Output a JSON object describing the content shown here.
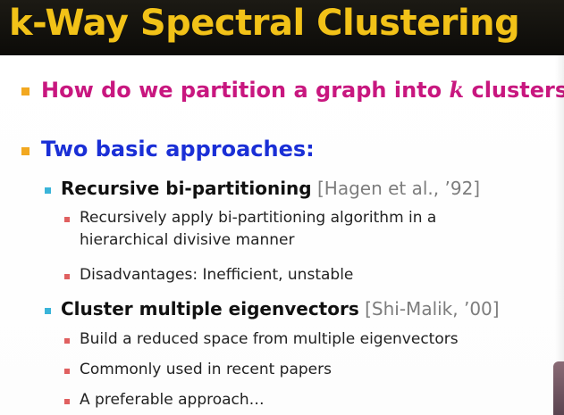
{
  "title": "k-Way Spectral Clustering",
  "q1": {
    "before": "How do we partition a graph into ",
    "k": "k",
    "after": " clusters?"
  },
  "q2": "Two basic approaches:",
  "approach1": {
    "name": "Recursive bi-partitioning",
    "cite": "[Hagen et al., ’92]",
    "points": [
      "Recursively apply bi-partitioning algorithm in a",
      "hierarchical divisive manner",
      "Disadvantages: Inefficient, unstable"
    ]
  },
  "approach2": {
    "name": "Cluster multiple eigenvectors",
    "cite": "[Shi-Malik, ’00]",
    "points": [
      "Build a reduced space from multiple eigenvectors",
      "Commonly used in recent papers",
      "A preferable approach…"
    ]
  },
  "colors": {
    "title_bg": "#0c0b08",
    "title_text": "#f2c218",
    "bullet_level1": "#f2a820",
    "bullet_level2": "#3ab4d9",
    "bullet_level3": "#e06060",
    "question_text": "#c8177f",
    "approaches_text": "#1a2fd6",
    "citation_text": "#7d7d7d"
  }
}
